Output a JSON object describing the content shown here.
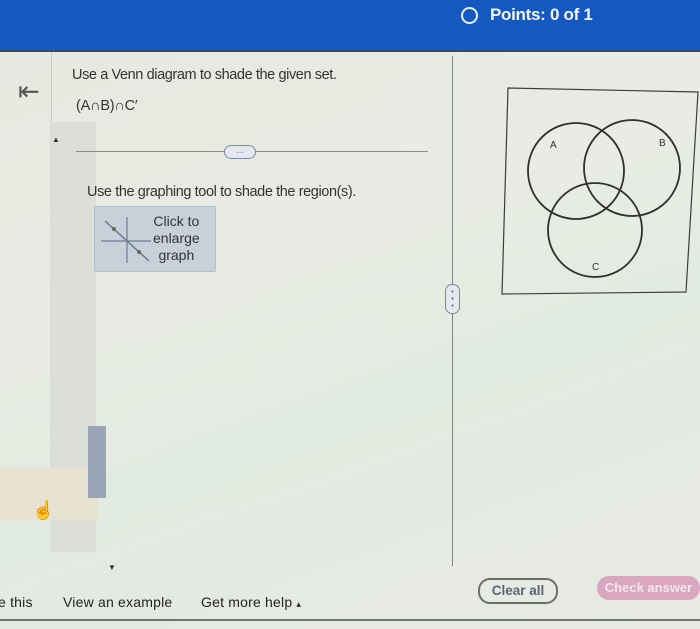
{
  "header": {
    "points_label": "Points:",
    "points_value": "0 of 1",
    "status_icon": "circle-outline-icon"
  },
  "nav": {
    "back_icon": "collapse-left-arrow-icon",
    "pointer_icon": "hand-cursor-icon",
    "scroll_up_icon": "triangle-up-icon",
    "scroll_down_icon": "triangle-down-icon"
  },
  "question": {
    "instruction": "Use a Venn diagram to shade the given set.",
    "expression": "(A∩B)∩C′",
    "tool_instruction": "Use the graphing tool to shade the region(s).",
    "enlarge_button": {
      "line1": "Click to",
      "line2": "enlarge",
      "line3": "graph",
      "icon": "graph-thumbnail-icon"
    },
    "divider_handle": "…"
  },
  "venn": {
    "labels": {
      "a": "A",
      "b": "B",
      "c": "C"
    },
    "shaded_regions": []
  },
  "footer": {
    "partial_link": "e this",
    "view_example": "View an example",
    "get_help": "Get more help",
    "get_help_caret": "▴",
    "clear_all": "Clear all",
    "check_answer": "Check answer"
  }
}
